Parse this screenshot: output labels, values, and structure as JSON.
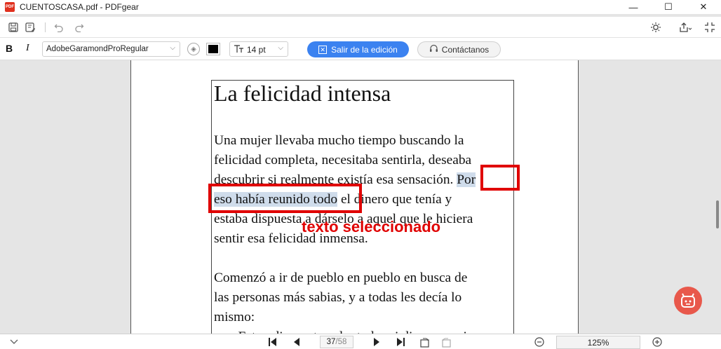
{
  "window": {
    "title": "CUENTOSCASA.pdf - PDFgear",
    "logo_text": "PDF",
    "minimize": "—",
    "maximize": "☐",
    "close": "✕"
  },
  "quickbar": {
    "icons": [
      "save-icon",
      "save-as-icon",
      "undo-icon",
      "redo-icon",
      "theme-icon",
      "share-icon",
      "collapse-icon"
    ]
  },
  "format_toolbar": {
    "bold": "B",
    "italic": "I",
    "font_family": "AdobeGaramondProRegular",
    "font_color": "#000000",
    "font_size": "14 pt",
    "exit_edit_label": "Salir de la edición",
    "contact_label": "Contáctanos",
    "accent_color": "#3b82f0"
  },
  "document": {
    "heading": "La felicidad intensa",
    "paragraph1": [
      "Una mujer llevaba mucho tiempo buscando la",
      "felicidad completa, necesitaba sentirla, deseaba",
      "descubrir si realmente existía esa sensación.",
      "Por",
      "eso había reunido todo",
      " el dinero que tenía y",
      "estaba dispuesta a dárselo a aquel que le hiciera",
      "sentir esa felicidad inmensa."
    ],
    "paragraph2": [
      "Comenzó a ir de pueblo en pueblo en busca de",
      "las personas más sabias, y a todas les decía lo",
      "mismo:",
      "– Estoy dispuesta a dar todo mi dinero a quien"
    ]
  },
  "annotation": {
    "label": "texto seleccionado",
    "color": "#e00000"
  },
  "bottombar": {
    "current_page": "37",
    "total_pages": "/58",
    "zoom": "125%"
  }
}
